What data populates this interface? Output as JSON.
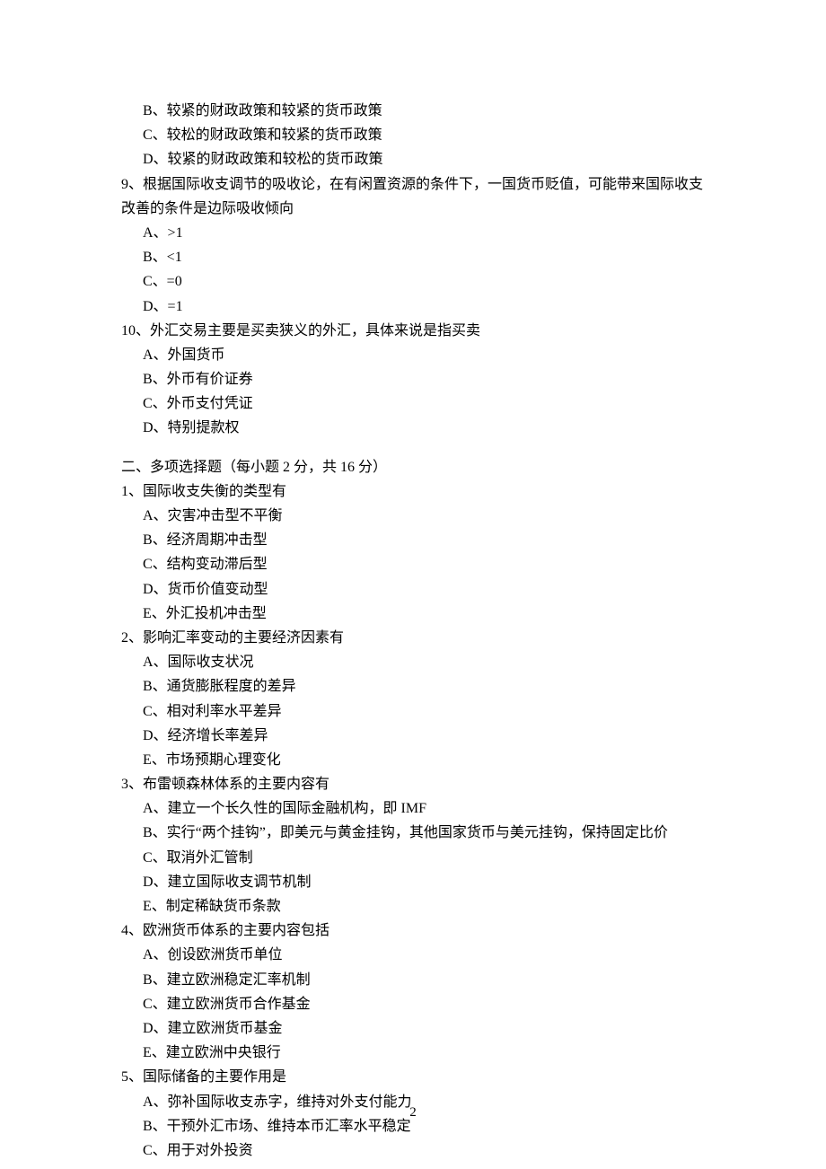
{
  "q8": {
    "optB": "B、较紧的财政政策和较紧的货币政策",
    "optC": "C、较松的财政政策和较紧的货币政策",
    "optD": "D、较紧的财政政策和较松的货币政策"
  },
  "q9": {
    "stem": "9、根据国际收支调节的吸收论，在有闲置资源的条件下，一国货币贬值，可能带来国际收支改善的条件是边际吸收倾向",
    "optA": "A、>1",
    "optB": "B、<1",
    "optC": "C、=0",
    "optD": "D、=1"
  },
  "q10": {
    "stem": "10、外汇交易主要是买卖狭义的外汇，具体来说是指买卖",
    "optA": "A、外国货币",
    "optB": "B、外币有价证券",
    "optC": "C、外币支付凭证",
    "optD": "D、特别提款权"
  },
  "section2": {
    "header": "二、多项选择题（每小题 2 分，共 16 分）"
  },
  "m1": {
    "stem": "1、国际收支失衡的类型有",
    "optA": "A、灾害冲击型不平衡",
    "optB": "B、经济周期冲击型",
    "optC": "C、结构变动滞后型",
    "optD": "D、货币价值变动型",
    "optE": "E、外汇投机冲击型"
  },
  "m2": {
    "stem": "2、影响汇率变动的主要经济因素有",
    "optA": "A、国际收支状况",
    "optB": "B、通货膨胀程度的差异",
    "optC": "C、相对利率水平差异",
    "optD": "D、经济增长率差异",
    "optE": "E、市场预期心理变化"
  },
  "m3": {
    "stem": "3、布雷顿森林体系的主要内容有",
    "optA": "A、建立一个长久性的国际金融机构，即 IMF",
    "optB": "B、实行“两个挂钩”，即美元与黄金挂钩，其他国家货币与美元挂钩，保持固定比价",
    "optC": "C、取消外汇管制",
    "optD": "D、建立国际收支调节机制",
    "optE": "E、制定稀缺货币条款"
  },
  "m4": {
    "stem": "4、欧洲货币体系的主要内容包括",
    "optA": "A、创设欧洲货币单位",
    "optB": "B、建立欧洲稳定汇率机制",
    "optC": "C、建立欧洲货币合作基金",
    "optD": "D、建立欧洲货币基金",
    "optE": "E、建立欧洲中央银行"
  },
  "m5": {
    "stem": "5、国际储备的主要作用是",
    "optA": "A、弥补国际收支赤字，维持对外支付能力",
    "optB": "B、干预外汇市场、维持本币汇率水平稳定",
    "optC": "C、用于对外投资"
  },
  "pageNumber": "2"
}
